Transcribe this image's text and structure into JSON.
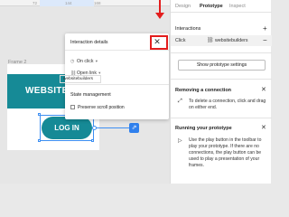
{
  "ruler": {
    "ticks": [
      "72",
      "144",
      "168"
    ]
  },
  "canvas": {
    "frame_label": "Frame 2",
    "banner_text": "WEBSITE",
    "login_button": "LOG IN"
  },
  "dialog": {
    "title": "Interaction details",
    "trigger": "On click",
    "action": "Open link",
    "url": "websitebuilders",
    "state_heading": "State management",
    "preserve_label": "Preserve scroll position"
  },
  "panel": {
    "tabs": [
      "Design",
      "Prototype",
      "Inspect"
    ],
    "active_tab": "Prototype",
    "interactions_heading": "Interactions",
    "interaction": {
      "trigger": "Click",
      "destination": "websitebuilders"
    },
    "show_settings": "Show prototype settings",
    "tip1": {
      "title": "Removing a connection",
      "text": "To delete a connection, click and drag on either end."
    },
    "tip2": {
      "title": "Running your prototype",
      "text": "Use the play button in the toolbar to play your prototype. If there are no connections, the play button can be used to play a presentation of your frames."
    }
  },
  "colors": {
    "accent_teal": "#168a96",
    "selection_blue": "#3d8ff2",
    "highlight_red": "#e31d1d"
  }
}
